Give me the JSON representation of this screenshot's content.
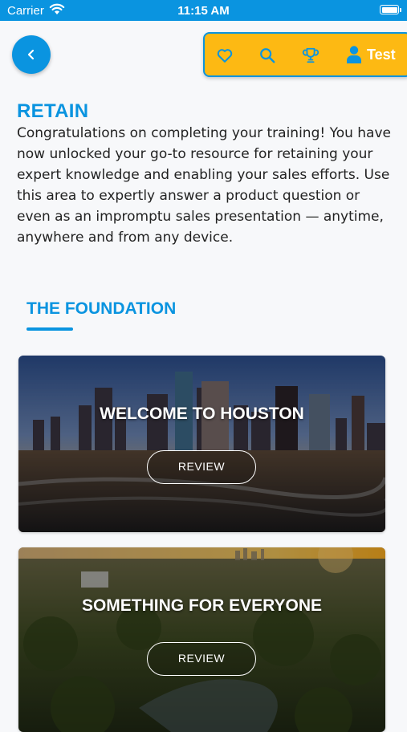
{
  "status_bar": {
    "carrier": "Carrier",
    "time": "11:15 AM"
  },
  "nav": {
    "icons": [
      "heart-icon",
      "search-icon",
      "trophy-icon",
      "user-icon"
    ],
    "user_label": "Test"
  },
  "retain": {
    "title": "RETAIN",
    "description": "Congratulations on completing your training! You have now unlocked your go-to resource for retaining your expert knowledge and enabling your sales efforts. Use this area to expertly answer a product question or even as an impromptu sales presentation — anytime, anywhere and from any device."
  },
  "section": {
    "title": "THE FOUNDATION"
  },
  "cards": [
    {
      "title": "WELCOME TO HOUSTON",
      "button": "REVIEW"
    },
    {
      "title": "SOMETHING FOR EVERYONE",
      "button": "REVIEW"
    }
  ],
  "colors": {
    "primary": "#0a94e0",
    "accent": "#fdb913",
    "text": "#222222",
    "background": "#f7f8fa"
  }
}
